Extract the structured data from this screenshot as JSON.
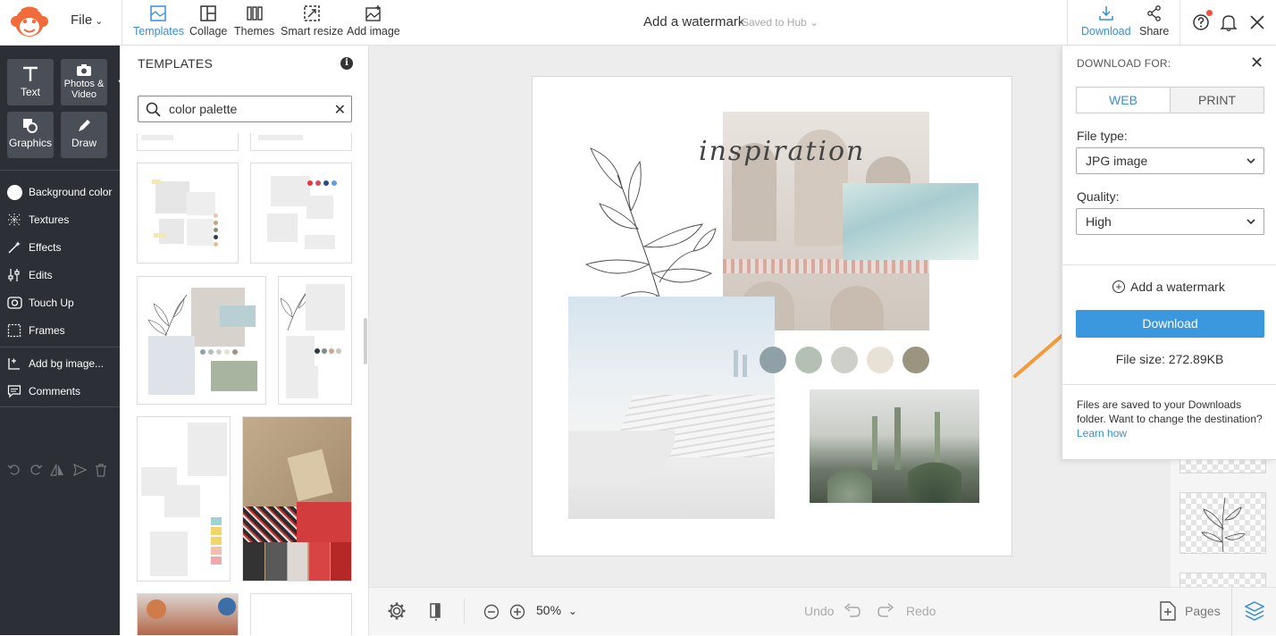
{
  "topbar": {
    "file_label": "File",
    "tools": [
      {
        "label": "Templates",
        "icon": "templates-icon"
      },
      {
        "label": "Collage",
        "icon": "collage-icon"
      },
      {
        "label": "Themes",
        "icon": "themes-icon"
      },
      {
        "label": "Smart resize",
        "icon": "smart-resize-icon"
      },
      {
        "label": "Add image",
        "icon": "add-image-icon"
      }
    ],
    "doc_title": "Add a watermark",
    "saved_status": "Saved to Hub",
    "download_label": "Download",
    "share_label": "Share",
    "accent_color": "#3b8ed0",
    "notification_color": "#f0533b"
  },
  "sidebar": {
    "tiles": [
      {
        "label": "Text",
        "icon": "text-icon"
      },
      {
        "label": "Photos & Video",
        "icon": "camera-icon"
      },
      {
        "label": "Graphics",
        "icon": "graphics-icon"
      },
      {
        "label": "Draw",
        "icon": "draw-icon"
      }
    ],
    "items": [
      {
        "label": "Background color",
        "icon": "background-color-icon"
      },
      {
        "label": "Textures",
        "icon": "textures-icon"
      },
      {
        "label": "Effects",
        "icon": "effects-icon"
      },
      {
        "label": "Edits",
        "icon": "edits-icon"
      },
      {
        "label": "Touch Up",
        "icon": "touch-up-icon"
      },
      {
        "label": "Frames",
        "icon": "frames-icon"
      },
      {
        "label": "Add bg image...",
        "icon": "add-bg-image-icon"
      },
      {
        "label": "Comments",
        "icon": "comments-icon"
      }
    ]
  },
  "templates": {
    "title": "TEMPLATES",
    "search_value": "color palette"
  },
  "canvas": {
    "script_text": "inspiration",
    "palette": [
      "#8fa1a6",
      "#b4c0b3",
      "#cfcfca",
      "#e8e1d6",
      "#9b9480"
    ]
  },
  "bottombar": {
    "zoom": "50%",
    "undo": "Undo",
    "redo": "Redo",
    "pages": "Pages"
  },
  "download_panel": {
    "heading": "DOWNLOAD FOR:",
    "tabs": [
      "WEB",
      "PRINT"
    ],
    "file_type_label": "File type:",
    "file_type_value": "JPG image",
    "quality_label": "Quality:",
    "quality_value": "High",
    "watermark_label": "Add a watermark",
    "download_button": "Download",
    "file_size": "File size: 272.89KB",
    "note": "Files are saved to your Downloads folder. Want to change the destination?",
    "learn_how": "Learn how"
  }
}
